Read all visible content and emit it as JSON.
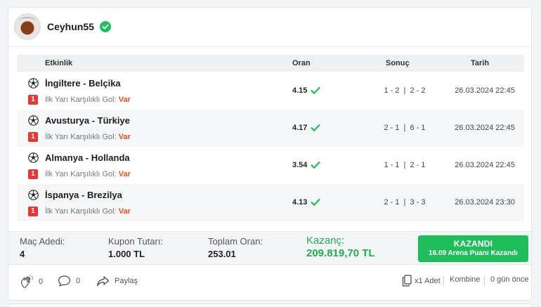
{
  "user": {
    "name": "Ceyhun55"
  },
  "table": {
    "headers": {
      "event": "Etkinlik",
      "odd": "Oran",
      "result": "Sonuç",
      "date": "Tarih"
    },
    "rows": [
      {
        "match": "İngiltere - Belçika",
        "market": "İlk Yarı Karşılıklı Gol:",
        "pick": "Var",
        "badge": "1",
        "odd": "4.15",
        "result": "1 - 2  |  2 - 2",
        "date": "26.03.2024 22:45"
      },
      {
        "match": "Avusturya - Türkiye",
        "market": "İlk Yarı Karşılıklı Gol:",
        "pick": "Var",
        "badge": "1",
        "odd": "4.17",
        "result": "2 - 1  |  6 - 1",
        "date": "26.03.2024 22:45"
      },
      {
        "match": "Almanya - Hollanda",
        "market": "İlk Yarı Karşılıklı Gol:",
        "pick": "Var",
        "badge": "1",
        "odd": "3.54",
        "result": "1 - 1  |  2 - 1",
        "date": "26.03.2024 22:45"
      },
      {
        "match": "İspanya - Brezilya",
        "market": "İlk Yarı Karşılıklı Gol:",
        "pick": "Var",
        "badge": "1",
        "odd": "4.13",
        "result": "2 - 1  |  3 - 3",
        "date": "26.03.2024 23:30"
      }
    ]
  },
  "summary": {
    "match_count_label": "Maç Adedi:",
    "match_count": "4",
    "stake_label": "Kupon Tutarı:",
    "stake": "1.000 TL",
    "total_odd_label": "Toplam Oran:",
    "total_odd": "253.01",
    "win_label": "Kazanç:",
    "win_amount": "209.819,70 TL",
    "status_title": "KAZANDI",
    "status_sub": "16.09 Arena Puanı Kazandı"
  },
  "footer": {
    "claps": "0",
    "comments": "0",
    "share_label": "Paylaş",
    "copies": "x1 Adet",
    "type": "Kombine",
    "time_ago": "0 gün önce"
  },
  "colors": {
    "accent_green": "#1fbe5a",
    "badge_red": "#e53935",
    "pick_orange": "#e8511e"
  },
  "icons": {
    "verified": "check-circle-icon",
    "ball": "soccer-ball-icon",
    "check": "check-icon",
    "clap": "clap-icon",
    "comment": "comment-icon",
    "share": "share-icon",
    "copy": "copy-icon"
  }
}
